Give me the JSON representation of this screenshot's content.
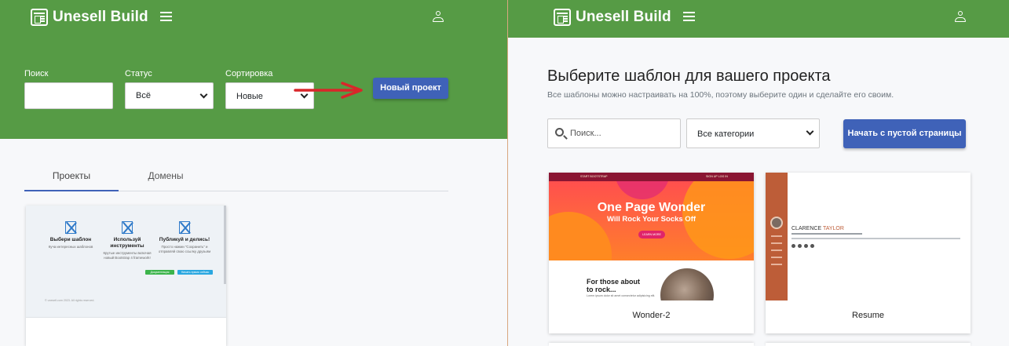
{
  "left": {
    "brand": "Unesell Build",
    "filters": {
      "search_label": "Поиск",
      "search_value": "",
      "status_label": "Статус",
      "status_value": "Всё",
      "sort_label": "Сортировка",
      "sort_value": "Новые"
    },
    "new_project_button": "Новый проект",
    "tabs": [
      {
        "label": "Проекты",
        "active": true
      },
      {
        "label": "Домены",
        "active": false
      }
    ],
    "project_card": {
      "columns": [
        {
          "title": "Выбери шаблон",
          "text": "Куча интересных шаблонов"
        },
        {
          "title": "Используй инструменты",
          "text": "Крутые инструменты включая новый Bootstrap 4 framework!"
        },
        {
          "title": "Публикуй и делись!",
          "text": "Просто нажми \"Сохранить\" и отправляй свою ссылку друзьям"
        }
      ],
      "btn_docs": "Документация",
      "btn_more": "Начать прямо сейчас",
      "footer": "© unesell.com 2023. All rights reserved."
    }
  },
  "right": {
    "brand": "Unesell Build",
    "title": "Выберите шаблон для вашего проекта",
    "subtitle": "Все шаблоны можно настраивать на 100%, поэтому выберите один и сделайте его своим.",
    "search_placeholder": "Поиск...",
    "category_value": "Все категории",
    "blank_button": "Начать с пустой страницы",
    "templates": [
      {
        "name": "Wonder-2",
        "preview": {
          "nav_brand": "START BOOTSTRAP",
          "nav_right": "SIGN UP   LOG IN",
          "heading": "One Page Wonder",
          "subheading": "Will Rock Your Socks Off",
          "cta": "LEARN MORE",
          "section_heading": "For those about to rock...",
          "section_text": "Lorem ipsum dolor sit amet consectetur adipisicing elit."
        }
      },
      {
        "name": "Resume",
        "preview": {
          "first_name": "CLARENCE",
          "last_name": "TAYLOR"
        }
      }
    ]
  },
  "colors": {
    "green": "#569b45",
    "blue": "#3f62b8",
    "arrow": "#d9262a"
  },
  "icons": [
    "logo-icon",
    "menu-icon",
    "user-icon",
    "search-icon",
    "chevron-down-icon",
    "arrow-right-icon"
  ]
}
